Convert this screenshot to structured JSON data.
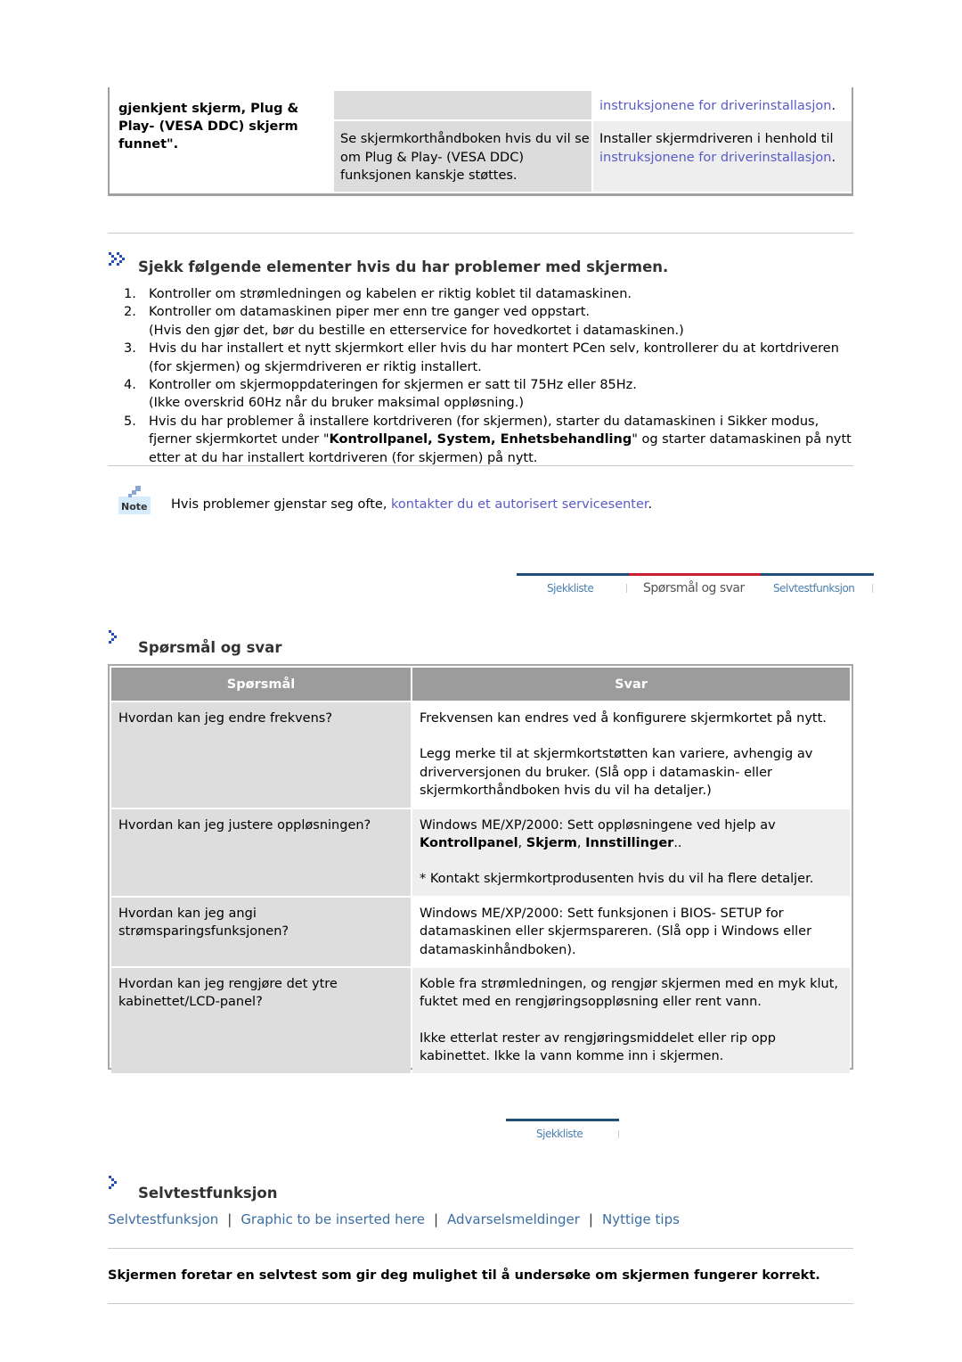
{
  "top_table": {
    "col1_text": "gjenkjent skjerm, Plug & Play- (VESA DDC) skjerm funnet\".",
    "col2_row2_text": "Se skjermkorthåndboken hvis du vil se om Plug & Play- (VESA DDC) funksjonen kanskje støttes.",
    "col3_row1_link": "instruksjonene for driverinstallasjon",
    "col3_row1_after": ".",
    "col3_row2_text": "Installer skjermdriveren i henhold til ",
    "col3_row2_link": "instruksjonene for driverinstallasjon",
    "col3_row2_after": "."
  },
  "checklist": {
    "icon": "double-chevron-right-icon",
    "title": "Sjekk følgende elementer hvis du har problemer med skjermen.",
    "items": [
      {
        "num": "1.",
        "text": "Kontroller om strømledningen og kabelen er riktig koblet til datamaskinen."
      },
      {
        "num": "2.",
        "text": "Kontroller om datamaskinen piper mer enn tre ganger ved oppstart.",
        "sub": "(Hvis den gjør det, bør du bestille en etterservice for hovedkortet i datamaskinen.)"
      },
      {
        "num": "3.",
        "text": "Hvis du har installert et nytt skjermkort eller hvis du har montert PCen selv, kontrollerer du at kortdriveren (for skjermen) og skjermdriveren er riktig installert."
      },
      {
        "num": "4.",
        "text": "Kontroller om skjermoppdateringen for skjermen er satt til 75Hz eller 85Hz.",
        "sub": "(Ikke overskrid 60Hz når du bruker maksimal oppløsning.)"
      },
      {
        "num": "5.",
        "text_before": "Hvis du har problemer å installere kortdriveren (for skjermen), starter du datamaskinen i Sikker modus, fjerner skjermkortet under \"",
        "bold": "Kontrollpanel, System, Enhetsbehandling",
        "text_after": "\" og starter datamaskinen på nytt etter at du har installert kortdriveren (for skjermen) på nytt."
      }
    ]
  },
  "note": {
    "icon_label": "Note",
    "text": "Hvis problemer gjenstar seg ofte, ",
    "link": "kontakter du et autorisert servicesenter",
    "after": "."
  },
  "tabs1": {
    "items": [
      "Sjekkliste",
      "Spørsmål og svar",
      "Selvtestfunksjon"
    ],
    "active": 1,
    "colors": {
      "bar": "#1f4e79",
      "active_bar": "#c8202e"
    }
  },
  "qa": {
    "title": "Spørsmål og svar",
    "headers": [
      "Spørsmål",
      "Svar"
    ],
    "rows": [
      {
        "q": "Hvordan kan jeg endre frekvens?",
        "a": [
          "Frekvensen kan endres ved å konfigurere skjermkortet på nytt.",
          "Legg merke til at skjermkortstøtten kan variere, avhengig av driverversjonen du bruker. (Slå opp i datamaskin- eller skjermkorthåndboken hvis du vil ha detaljer.)"
        ]
      },
      {
        "q": "Hvordan kan jeg justere oppløsningen?",
        "a1": "Windows ME/XP/2000: Sett oppløsningene ved hjelp av ",
        "a1_b1": "Kontrollpanel",
        "a1_s1": ", ",
        "a1_b2": "Skjerm",
        "a1_s2": ", ",
        "a1_b3": "Innstillinger",
        "a1_end": "..",
        "a2": "* Kontakt skjermkortprodusenten hvis du vil ha flere detaljer."
      },
      {
        "q": "Hvordan kan jeg angi strømsparingsfunksjonen?",
        "a": [
          "Windows ME/XP/2000: Sett funksjonen i BIOS- SETUP for datamaskinen eller skjermspareren. (Slå opp i Windows eller datamaskinhåndboken)."
        ]
      },
      {
        "q": "Hvordan kan jeg rengjøre det ytre kabinettet/LCD-panel?",
        "a": [
          "Koble fra strømledningen, og rengjør skjermen med en myk klut, fuktet med en rengjøringsoppløsning eller rent vann.",
          "Ikke etterlat rester av rengjøringsmiddelet eller rip opp kabinettet. Ikke la vann komme inn i skjermen."
        ]
      }
    ]
  },
  "tabs2": {
    "items": [
      "Sjekkliste"
    ]
  },
  "selftest": {
    "title": "Selvtestfunksjon",
    "links": [
      "Selvtestfunksjon",
      "Graphic to be inserted here",
      "Advarselsmeldinger",
      "Nyttige tips"
    ],
    "separator": "|",
    "statement": "Skjermen foretar en selvtest som gir deg mulighet til å undersøke om skjermen fungerer korrekt."
  }
}
